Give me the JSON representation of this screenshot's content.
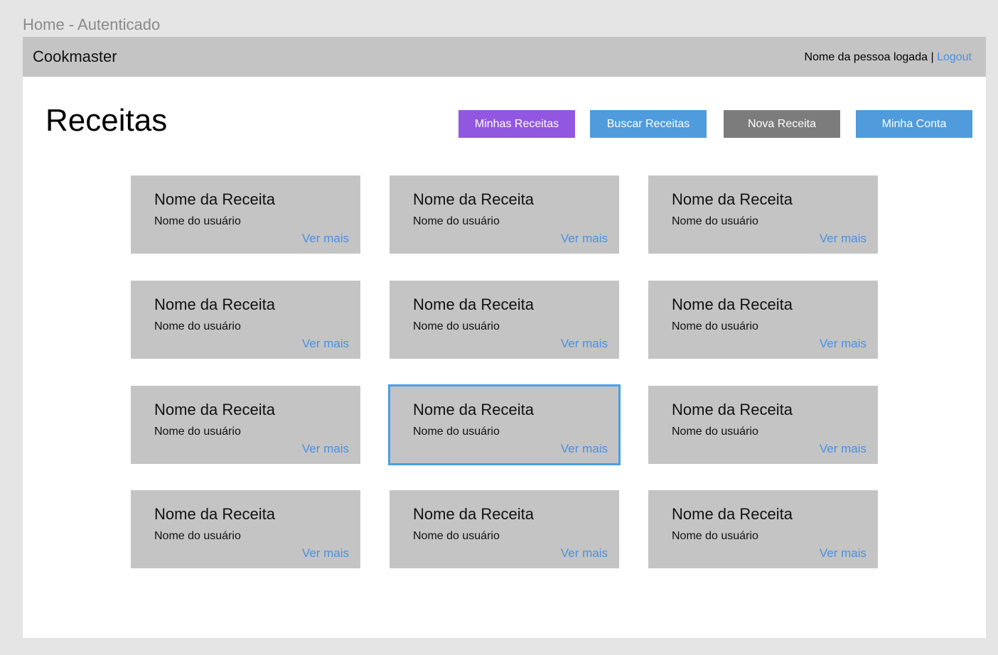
{
  "frame_label": "Home - Autenticado",
  "header": {
    "brand": "Cookmaster",
    "user_name": "Nome da pessoa logada |",
    "logout_label": "Logout"
  },
  "page": {
    "title": "Receitas"
  },
  "actions": {
    "minhas": "Minhas Receitas",
    "buscar": "Buscar Receitas",
    "nova": "Nova Receita",
    "conta": "Minha Conta"
  },
  "colors": {
    "accent_purple": "#9257e0",
    "accent_blue": "#4f9bdc",
    "neutral_gray": "#7c7c7c",
    "link_blue": "#4a90e2",
    "card_gray": "#c4c4c4",
    "selected_border": "#4a9fe8"
  },
  "recipes": [
    {
      "title": "Nome da Receita",
      "user": "Nome do usuário",
      "more": "Ver mais"
    },
    {
      "title": "Nome da Receita",
      "user": "Nome do usuário",
      "more": "Ver mais"
    },
    {
      "title": "Nome da Receita",
      "user": "Nome do usuário",
      "more": "Ver mais"
    },
    {
      "title": "Nome da Receita",
      "user": "Nome do usuário",
      "more": "Ver mais"
    },
    {
      "title": "Nome da Receita",
      "user": "Nome do usuário",
      "more": "Ver mais"
    },
    {
      "title": "Nome da Receita",
      "user": "Nome do usuário",
      "more": "Ver mais"
    },
    {
      "title": "Nome da Receita",
      "user": "Nome do usuário",
      "more": "Ver mais"
    },
    {
      "title": "Nome da Receita",
      "user": "Nome do usuário",
      "more": "Ver mais",
      "selected": true
    },
    {
      "title": "Nome da Receita",
      "user": "Nome do usuário",
      "more": "Ver mais"
    },
    {
      "title": "Nome da Receita",
      "user": "Nome do usuário",
      "more": "Ver mais"
    },
    {
      "title": "Nome da Receita",
      "user": "Nome do usuário",
      "more": "Ver mais"
    },
    {
      "title": "Nome da Receita",
      "user": "Nome do usuário",
      "more": "Ver mais"
    }
  ]
}
